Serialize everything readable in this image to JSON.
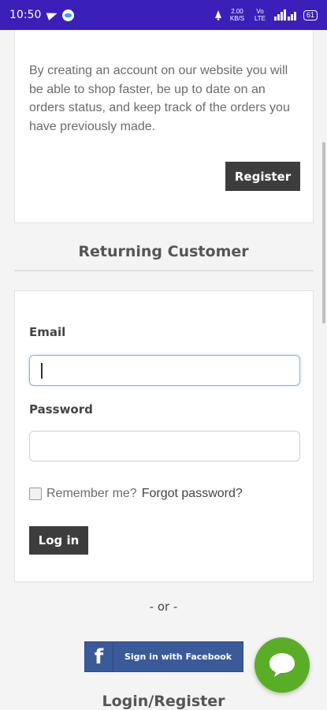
{
  "status_bar": {
    "time": "10:50",
    "speed": "2.00 KB/S",
    "signal": "Vo LTE",
    "battery": "61"
  },
  "register_card": {
    "description": "By creating an account on our website you will be able to shop faster, be up to date on an orders status, and keep track of the orders you have previously made.",
    "register_label": "Register"
  },
  "returning": {
    "title": "Returning Customer",
    "email_label": "Email",
    "email_value": "",
    "password_label": "Password",
    "password_value": "",
    "remember_label": "Remember me?",
    "forgot_label": "Forgot password?",
    "login_label": "Log in"
  },
  "or_text": "- or -",
  "facebook": {
    "letter": "f",
    "label": "Sign in with Facebook"
  },
  "bottom_heading": "Login/Register",
  "colors": {
    "status_bar": "#3a1fb8",
    "button_dark": "#3d3d3d",
    "facebook_blue": "#3b5a9a",
    "chat_green": "#5aae27"
  }
}
